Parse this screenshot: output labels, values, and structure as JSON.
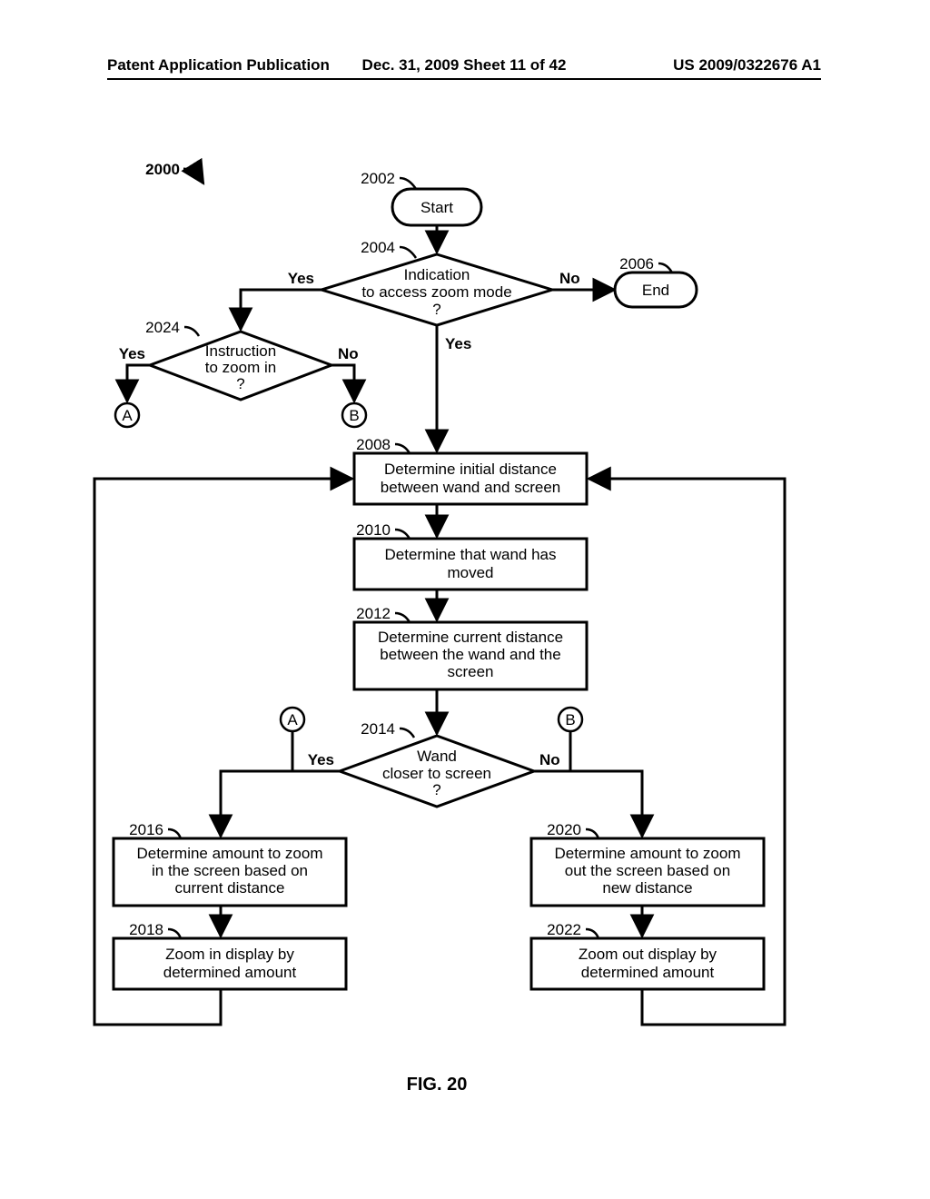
{
  "header": {
    "left": "Patent Application Publication",
    "mid": "Dec. 31, 2009  Sheet 11 of 42",
    "right": "US 2009/0322676 A1"
  },
  "figtitle": "FIG. 20",
  "num2000": "2000",
  "num2002": "2002",
  "num2004": "2004",
  "num2006": "2006",
  "num2008": "2008",
  "num2010": "2010",
  "num2012": "2012",
  "num2014": "2014",
  "num2016": "2016",
  "num2018": "2018",
  "num2020": "2020",
  "num2022": "2022",
  "num2024": "2024",
  "start": "Start",
  "end": "End",
  "dec2004_l1": "Indication",
  "dec2004_l2": "to access zoom mode",
  "dec2004_l3": "?",
  "dec2024_l1": "Instruction",
  "dec2024_l2": "to zoom in",
  "dec2024_l3": "?",
  "box2008_l1": "Determine initial distance",
  "box2008_l2": "between wand and screen",
  "box2010_l1": "Determine that wand has",
  "box2010_l2": "moved",
  "box2012_l1": "Determine current distance",
  "box2012_l2": "between the wand and the",
  "box2012_l3": "screen",
  "dec2014_l1": "Wand",
  "dec2014_l2": "closer to screen",
  "dec2014_l3": "?",
  "box2016_l1": "Determine amount to zoom",
  "box2016_l2": "in the screen based on",
  "box2016_l3": "current distance",
  "box2018_l1": "Zoom in display by",
  "box2018_l2": "determined amount",
  "box2020_l1": "Determine amount to zoom",
  "box2020_l2": "out the screen based on",
  "box2020_l3": "new distance",
  "box2022_l1": "Zoom out display by",
  "box2022_l2": "determined amount",
  "yes": "Yes",
  "no": "No",
  "connA": "A",
  "connB": "B"
}
